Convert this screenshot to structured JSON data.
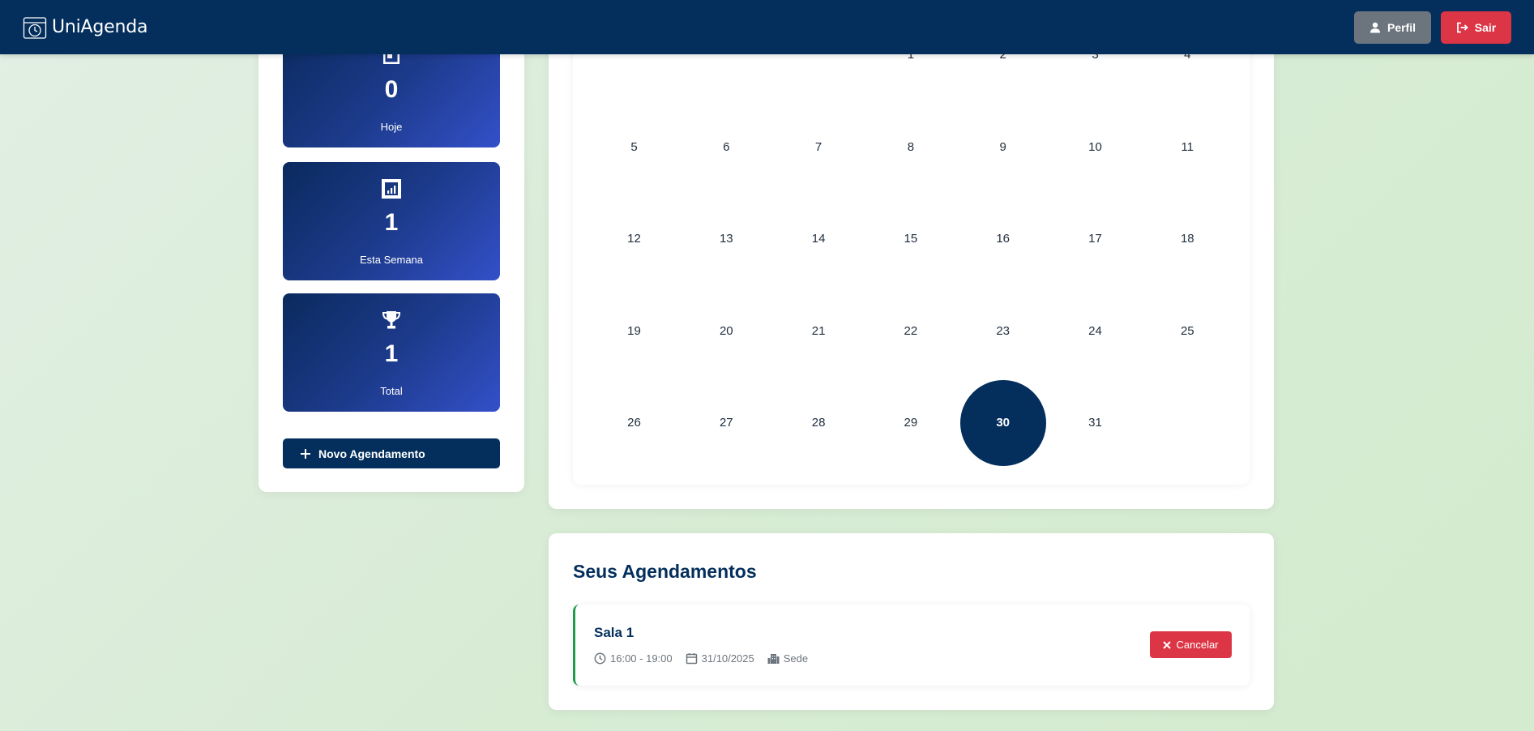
{
  "navbar": {
    "brand": "UniAgenda",
    "profile_label": "Perfil",
    "logout_label": "Sair"
  },
  "stats": [
    {
      "icon": "calendar-day-icon",
      "value": "0",
      "label": "Hoje"
    },
    {
      "icon": "chart-bar-icon",
      "value": "1",
      "label": "Esta Semana"
    },
    {
      "icon": "trophy-icon",
      "value": "1",
      "label": "Total"
    }
  ],
  "new_appointment_label": "Novo Agendamento",
  "calendar": {
    "days": [
      "1",
      "2",
      "3",
      "4",
      "5",
      "6",
      "7",
      "8",
      "9",
      "10",
      "11",
      "12",
      "13",
      "14",
      "15",
      "16",
      "17",
      "18",
      "19",
      "20",
      "21",
      "22",
      "23",
      "24",
      "25",
      "26",
      "27",
      "28",
      "29",
      "30",
      "31"
    ],
    "first_weekday_index": 3,
    "selected_day": "30"
  },
  "appointments": {
    "title": "Seus Agendamentos",
    "items": [
      {
        "name": "Sala 1",
        "time": "16:00 - 19:00",
        "date": "31/10/2025",
        "location": "Sede",
        "cancel_label": "Cancelar",
        "accent_color": "#1e9e4a"
      }
    ]
  },
  "colors": {
    "primary": "#042f5c",
    "danger": "#dc3545",
    "secondary": "#6c757d"
  }
}
